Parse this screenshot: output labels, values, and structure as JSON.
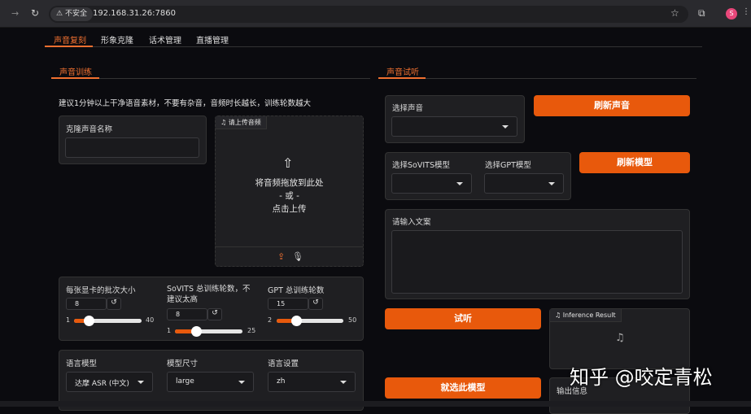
{
  "browser": {
    "security": "不安全",
    "url": "192.168.31.26:7860",
    "profile": "S"
  },
  "tabs": [
    "声音复刻",
    "形象克隆",
    "话术管理",
    "直播管理"
  ],
  "train": {
    "title": "声音训练",
    "hint": "建议1分钟以上干净语音素材，不要有杂音，音频时长越长，训练轮数越大",
    "clone_name_label": "克隆声音名称",
    "upload": {
      "label": "请上传音频",
      "drop": "将音频拖放到此处",
      "or": "- 或 -",
      "click": "点击上传"
    },
    "batch": {
      "label": "每张显卡的批次大小",
      "value": "8",
      "min": "1",
      "max": "40",
      "fraction": 0.18
    },
    "sovits": {
      "label": "SoVITS 总训练轮数，不建议太高",
      "value": "8",
      "min": "1",
      "max": "25",
      "fraction": 0.29
    },
    "gpt": {
      "label": "GPT 总训练轮数",
      "value": "15",
      "min": "2",
      "max": "50",
      "fraction": 0.27
    },
    "lang_model": {
      "label": "语言模型",
      "value": "达摩 ASR (中文)"
    },
    "model_size": {
      "label": "模型尺寸",
      "value": "large"
    },
    "lang": {
      "label": "语言设置",
      "value": "zh"
    }
  },
  "listen": {
    "title": "声音试听",
    "select_voice": "选择声音",
    "refresh_voice": "刷新声音",
    "sovits_model": "选择SoVITS模型",
    "gpt_model": "选择GPT模型",
    "refresh_model": "刷新模型",
    "text_label": "请输入文案",
    "listen_btn": "试听",
    "result_label": "Inference Result",
    "choose_btn": "就选此模型",
    "output_label": "输出信息"
  },
  "watermark": "知乎 @咬定青松"
}
